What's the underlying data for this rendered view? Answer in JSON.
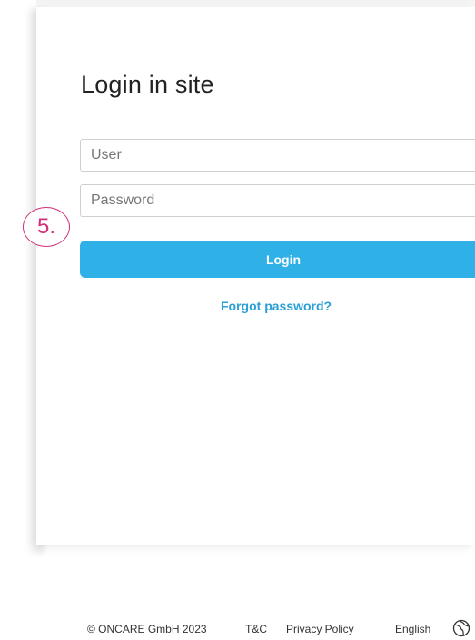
{
  "step_badge": "5.",
  "login": {
    "title": "Login in site",
    "user_placeholder": "User",
    "password_placeholder": "Password",
    "button_label": "Login",
    "forgot_label": "Forgot password?"
  },
  "footer": {
    "copyright": "© ONCARE GmbH 2023",
    "terms": "T&C",
    "privacy": "Privacy Policy",
    "language": "English",
    "language_icon": "globe-icon"
  },
  "colors": {
    "accent": "#2fb0e6",
    "link": "#2a9fd6",
    "badge": "#d2317a"
  }
}
